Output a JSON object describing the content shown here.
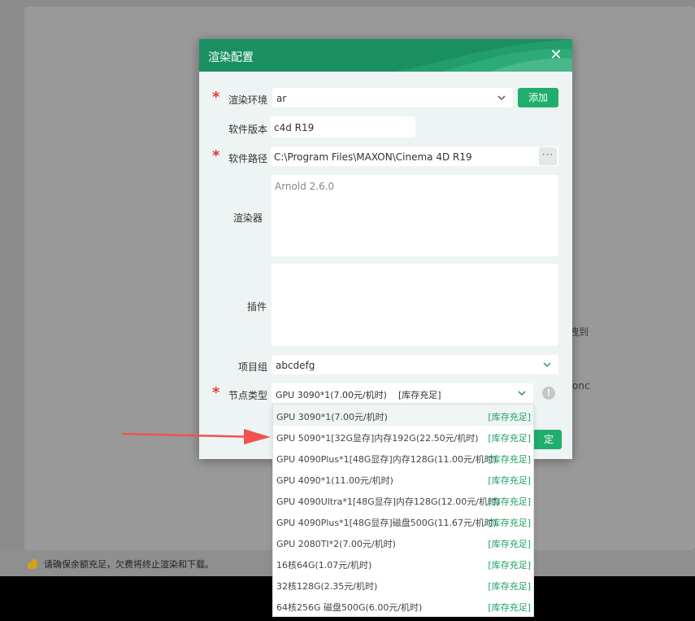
{
  "background": {
    "side_text_1": "拽到",
    "side_text_2": "onc",
    "footer_notice": "请确保余额充足，欠费将终止渲染和下载。"
  },
  "dialog": {
    "title": "渲染配置",
    "close_icon": "close-icon",
    "fields": {
      "render_env": {
        "label": "渲染环境",
        "value": "ar",
        "add_label": "添加"
      },
      "software_version": {
        "label": "软件版本",
        "value": "c4d R19"
      },
      "software_path": {
        "label": "软件路径",
        "value": "C:\\Program Files\\MAXON\\Cinema 4D R19",
        "browse_label": "···"
      },
      "renderer": {
        "label": "渲染器",
        "value": "Arnold 2.6.0"
      },
      "plugins": {
        "label": "插件",
        "value": ""
      },
      "project_group": {
        "label": "项目组",
        "value": "abcdefg"
      },
      "node_type": {
        "label": "节点类型",
        "value": "GPU 3090*1(7.00元/机时)    [库存充足]",
        "info_label": "!"
      }
    },
    "confirm_label": "定"
  },
  "node_options": [
    {
      "name": "GPU 3090*1(7.00元/机时)",
      "stock": "[库存充足]",
      "selected": true
    },
    {
      "name": "GPU 5090*1[32G显存]内存192G(22.50元/机时)",
      "stock": "[库存充足]"
    },
    {
      "name": "GPU 4090Plus*1[48G显存]内存128G(11.00元/机时)",
      "stock": "[库存充足]"
    },
    {
      "name": "GPU 4090*1(11.00元/机时)",
      "stock": "[库存充足]"
    },
    {
      "name": "GPU 4090Ultra*1[48G显存]内存128G(12.00元/机时)",
      "stock": "[库存充足]"
    },
    {
      "name": "GPU 4090Plus*1[48G显存]磁盘500G(11.67元/机时)",
      "stock": "[库存充足]"
    },
    {
      "name": "GPU 2080TI*2(7.00元/机时)",
      "stock": "[库存充足]"
    },
    {
      "name": "16核64G(1.07元/机时)",
      "stock": "[库存充足]"
    },
    {
      "name": "32核128G(2.35元/机时)",
      "stock": "[库存充足]"
    },
    {
      "name": "64核256G 磁盘500G(6.00元/机时)",
      "stock": "[库存充足]"
    }
  ],
  "colors": {
    "accent": "#1fae6b",
    "header": "#1a8f62",
    "required": "#e53935",
    "stock": "#1aa260",
    "annotation_arrow": "#ef5350"
  }
}
